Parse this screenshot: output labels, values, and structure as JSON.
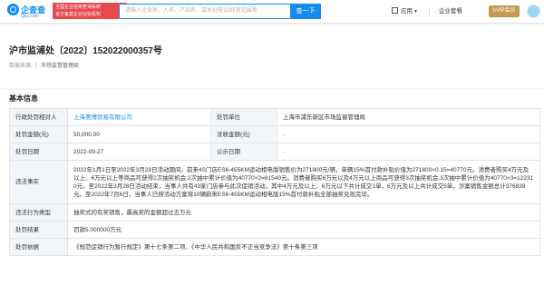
{
  "header": {
    "logo_title": "企查查",
    "logo_sub": "Qcc.com",
    "notice_line1": "全国企业信用查询系统",
    "notice_line2": "官方备案企业征信机构",
    "search_placeholder": "请输入企业名、人名、产品名、或地址电话/经营范围等",
    "search_button": "查一下",
    "nav_apps": "应用",
    "nav_enterprise": "企业套餐",
    "svip": "SVIP会员"
  },
  "title_block": {
    "title": "沪市监浦处〔2022〕152022000357号",
    "source_label": "数据来源",
    "source_value": "市场监督管理局"
  },
  "section": {
    "title": "基本信息"
  },
  "table": {
    "row1": {
      "label_a": "行政处罚相对人",
      "value_a": "上海奥博贸易有限公司",
      "label_b": "处罚单位",
      "value_b": "上海市浦东新区市场监督管理局"
    },
    "row2": {
      "label_a": "处罚金额(元)",
      "value_a": "50,000.00",
      "label_b": "没收金额(元)",
      "value_b": "-"
    },
    "row3": {
      "label_a": "处罚日期",
      "value_a": "2022-09-27",
      "label_b": "公示日期",
      "value_b": "-"
    },
    "facts": {
      "label": "违法事实",
      "value": "2022年1月1日至2022年3月28日活动期间，前来4S门店ES6-455KM运动相电版销售价为271800元/辆，单辆15%首付款补贴价值为271800×0.15=40770元。消费者购买4万元及以上、6万元以上等商品可获得2次抽奖机会,2次抽中累计价值为40770×2=81540元。消费者购买6万元以及4万元以上商品可获得3次抽奖机会,3次抽中累计价值为40770×3=122310元。至2022年3月28日活动结束，当事人共有43家门店参与此次促销活动，其中4万元及以上、6万元以下共计成交1单，6万元及以上共计成交5单，涉案销售金额总计376839元。至2022年7月6日，当事人已按活动方案将10辆蔚来ES6-455KM运动相电版15%首付款补贴全部抽奖兑现完毕。"
    },
    "type": {
      "label": "违法行为类型",
      "value": "抽奖式的有奖销售，最高奖的金额超过五万元"
    },
    "result": {
      "label": "处罚结果",
      "value": "罚款5.000000万元"
    },
    "basis": {
      "label": "处罚依据",
      "value": "《规范促销行为暂行规定》第十七条第二项、《中华人民共和国反不正当竞争法》第十条第三项"
    }
  }
}
